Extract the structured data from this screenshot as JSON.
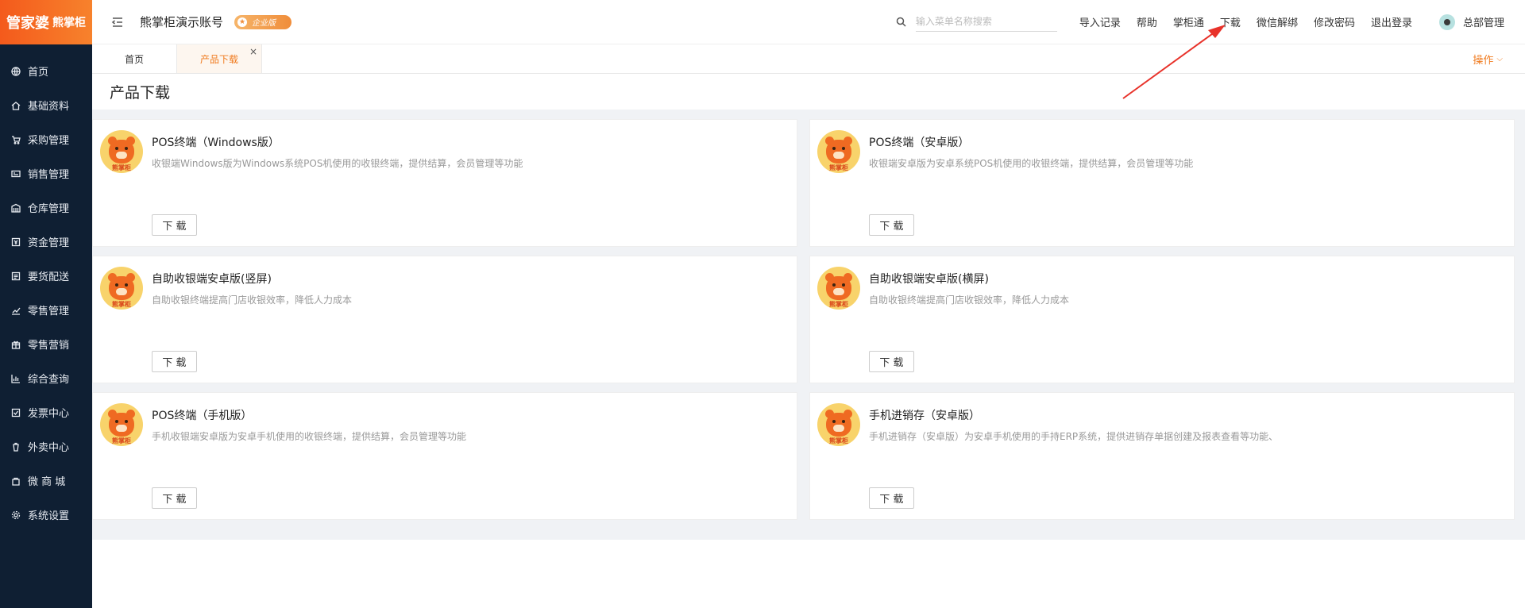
{
  "brand": {
    "name_main": "管家婆",
    "name_sub": "熊掌柜"
  },
  "sidebar": {
    "items": [
      {
        "label": "首页",
        "icon": "globe-icon"
      },
      {
        "label": "基础资料",
        "icon": "home-icon"
      },
      {
        "label": "采购管理",
        "icon": "cart-icon"
      },
      {
        "label": "销售管理",
        "icon": "sales-icon"
      },
      {
        "label": "仓库管理",
        "icon": "warehouse-icon"
      },
      {
        "label": "资金管理",
        "icon": "money-icon"
      },
      {
        "label": "要货配送",
        "icon": "delivery-icon"
      },
      {
        "label": "零售管理",
        "icon": "retail-icon"
      },
      {
        "label": "零售营销",
        "icon": "gift-icon"
      },
      {
        "label": "综合查询",
        "icon": "chart-icon"
      },
      {
        "label": "发票中心",
        "icon": "invoice-icon"
      },
      {
        "label": "外卖中心",
        "icon": "takeout-icon"
      },
      {
        "label": "微 商 城",
        "icon": "shop-icon"
      },
      {
        "label": "系统设置",
        "icon": "gear-icon"
      }
    ]
  },
  "header": {
    "account_title": "熊掌柜演示账号",
    "badge_label": "企业版",
    "search_placeholder": "输入菜单名称搜索",
    "links": [
      "导入记录",
      "帮助",
      "掌柜通",
      "下载",
      "微信解绑",
      "修改密码",
      "退出登录"
    ],
    "user_name": "总部管理"
  },
  "tabs": {
    "items": [
      {
        "label": "首页"
      },
      {
        "label": "产品下载",
        "close": "×"
      }
    ],
    "ops_label": "操作",
    "ops_chevron": "⌵"
  },
  "page": {
    "title": "产品下载"
  },
  "products": [
    {
      "title": "POS终端（Windows版）",
      "desc": "收银端Windows版为Windows系统POS机使用的收银终端，提供结算，会员管理等功能",
      "button": "下 载",
      "logo_text": "熊掌柜"
    },
    {
      "title": "POS终端（安卓版）",
      "desc": "收银端安卓版为安卓系统POS机使用的收银终端，提供结算，会员管理等功能",
      "button": "下 载",
      "logo_text": "熊掌柜"
    },
    {
      "title": "自助收银端安卓版(竖屏)",
      "desc": "自助收银终端提高门店收银效率，降低人力成本",
      "button": "下 载",
      "logo_text": "熊掌柜"
    },
    {
      "title": "自助收银端安卓版(横屏)",
      "desc": "自助收银终端提高门店收银效率，降低人力成本",
      "button": "下 载",
      "logo_text": "熊掌柜"
    },
    {
      "title": "POS终端（手机版）",
      "desc": "手机收银端安卓版为安卓手机使用的收银终端，提供结算，会员管理等功能",
      "button": "下 载",
      "logo_text": "熊掌柜"
    },
    {
      "title": "手机进销存（安卓版）",
      "desc": "手机进销存（安卓版）为安卓手机使用的手持ERP系统，提供进销存单据创建及报表查看等功能、",
      "button": "下 载",
      "logo_text": "熊掌柜"
    }
  ],
  "colors": {
    "accent": "#f07b1f",
    "sidebar_bg": "#0f1f33",
    "annotation_arrow": "#e8322a"
  }
}
